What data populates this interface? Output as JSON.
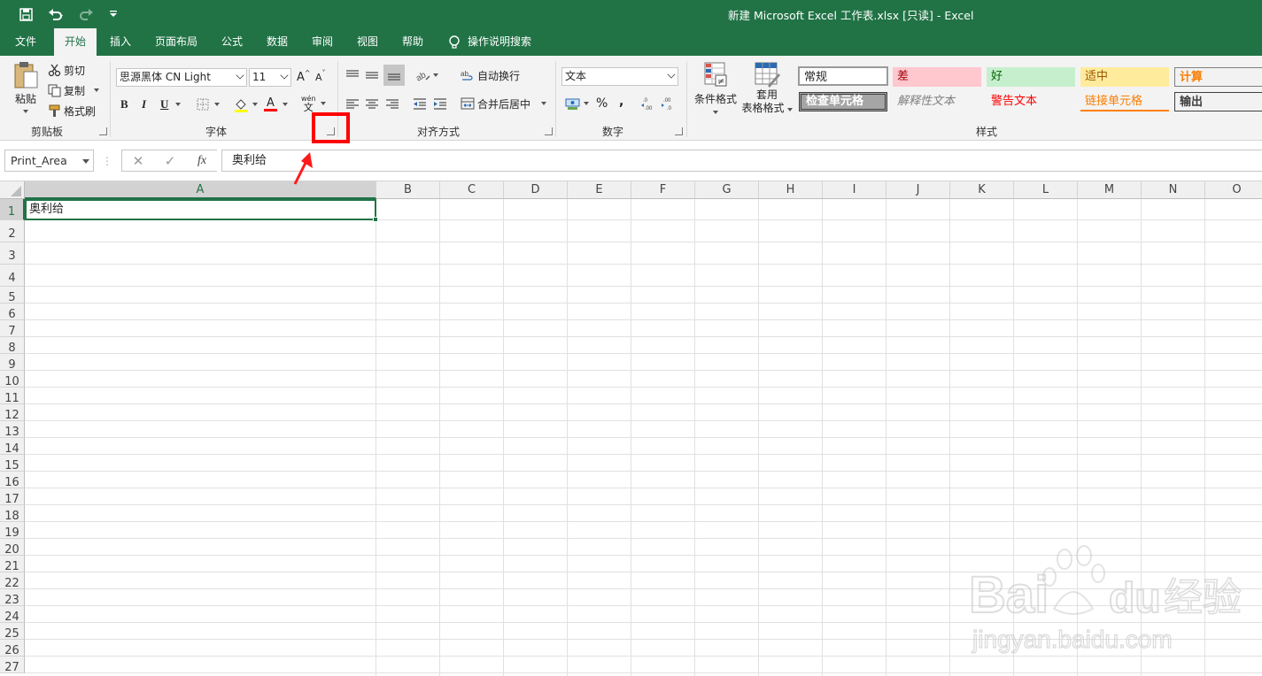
{
  "titlebar": {
    "title": "新建 Microsoft Excel 工作表.xlsx  [只读]  -  Excel",
    "save_icon": "save-icon",
    "undo_icon": "undo-icon",
    "redo_icon": "redo-icon",
    "customize_icon": "customize-qat-icon",
    "bg_color": "#217346"
  },
  "tabs": [
    {
      "label": "文件"
    },
    {
      "label": "开始",
      "active": true
    },
    {
      "label": "插入"
    },
    {
      "label": "页面布局"
    },
    {
      "label": "公式"
    },
    {
      "label": "数据"
    },
    {
      "label": "审阅"
    },
    {
      "label": "视图"
    },
    {
      "label": "帮助"
    },
    {
      "label": "操作说明搜索"
    }
  ],
  "ribbon": {
    "clipboard": {
      "label": "剪贴板",
      "paste": "粘贴",
      "cut": "剪切",
      "copy": "复制",
      "format_painter": "格式刷"
    },
    "font": {
      "label": "字体",
      "font_name": "思源黑体 CN Light",
      "font_size": "11",
      "bold": "B",
      "italic": "I",
      "underline": "U",
      "grow": "A",
      "shrink": "A",
      "font_color_letter": "A",
      "phonetic_top": "wén",
      "phonetic_bottom": "文"
    },
    "alignment": {
      "label": "对齐方式",
      "wrap_text": "自动换行",
      "merge_center": "合并后居中"
    },
    "number": {
      "label": "数字",
      "format": "文本",
      "percent": "%",
      "comma": ","
    },
    "styles": {
      "label": "样式",
      "conditional": "条件格式",
      "table_line1": "套用",
      "table_line2": "表格格式",
      "cells": [
        {
          "text": "常规",
          "color": "#000000",
          "bg": "#ffffff"
        },
        {
          "text": "差",
          "color": "#9c0006",
          "bg": "#ffc7ce"
        },
        {
          "text": "好",
          "color": "#006100",
          "bg": "#c6efce"
        },
        {
          "text": "适中",
          "color": "#9c5700",
          "bg": "#ffeb9c"
        },
        {
          "text": "计算",
          "color": "#fa7d00",
          "bg": "#f2f2f2"
        },
        {
          "text": "检查单元格",
          "color": "#ffffff",
          "bg": "#a5a5a5"
        },
        {
          "text": "解释性文本",
          "color": "#7f7f7f",
          "bg": "#ffffff"
        },
        {
          "text": "警告文本",
          "color": "#ff0000",
          "bg": "#ffffff"
        },
        {
          "text": "链接单元格",
          "color": "#fa7d00",
          "bg": "#ffffff"
        },
        {
          "text": "输出",
          "color": "#3f3f3f",
          "bg": "#f2f2f2"
        }
      ]
    }
  },
  "formula_bar": {
    "name_box": "Print_Area",
    "fx": "fx",
    "content": "奥利给"
  },
  "sheet": {
    "columns": [
      "A",
      "B",
      "C",
      "D",
      "E",
      "F",
      "G",
      "H",
      "I",
      "J",
      "K",
      "L",
      "M",
      "N",
      "O"
    ],
    "rows": [
      "1",
      "2",
      "3",
      "4",
      "5",
      "6",
      "7",
      "8",
      "9",
      "10",
      "11",
      "12",
      "13",
      "14",
      "15",
      "16",
      "17",
      "18",
      "19",
      "20",
      "21",
      "22",
      "23",
      "24",
      "25",
      "26",
      "27"
    ],
    "selected_column": "A",
    "selected_row": "1",
    "cell_a1": "奥利给"
  },
  "annotation": {
    "highlight_color": "#ff0000",
    "target": "font-dialog-launcher"
  },
  "watermark": {
    "brand": "Bai",
    "brand2": "du",
    "suffix": "经验",
    "url": "jingyan.baidu.com"
  }
}
